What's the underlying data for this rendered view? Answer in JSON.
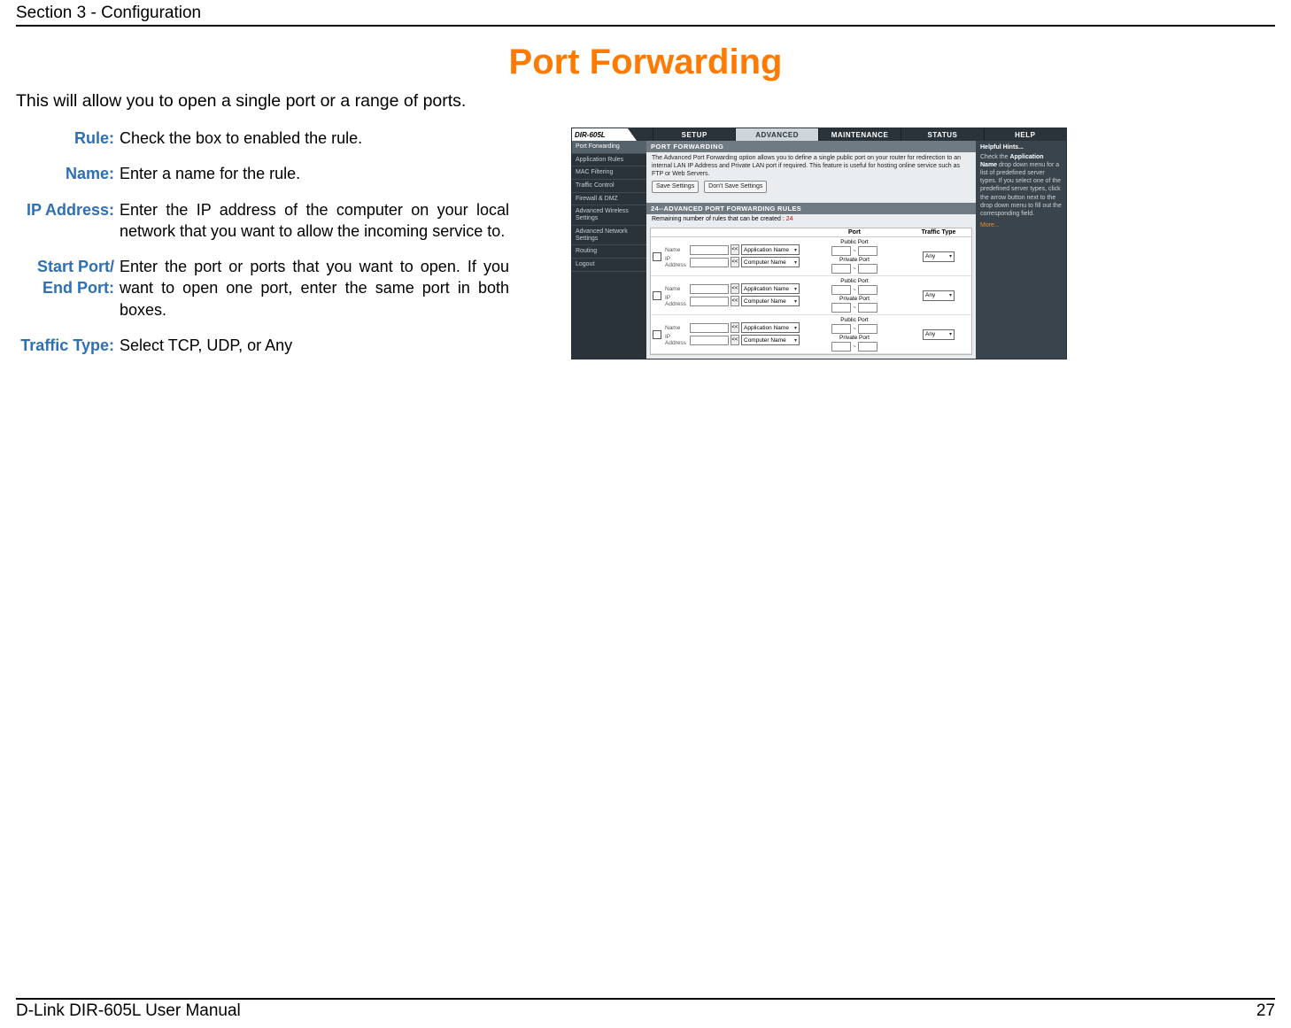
{
  "header": {
    "section": "Section 3 - Configuration"
  },
  "title": "Port Forwarding",
  "intro": "This will allow you to open a single port or a range of ports.",
  "defs": [
    {
      "term": "Rule:",
      "def": "Check the box to enabled the rule."
    },
    {
      "term": "Name:",
      "def": "Enter a name for the rule."
    },
    {
      "term": "IP Address:",
      "def": "Enter the IP address of the computer on your local network that you want to allow the incoming service to."
    },
    {
      "term": "Start Port/ End Port:",
      "def": "Enter the port or ports that you want to open. If you want to open one port, enter the same port in both boxes."
    },
    {
      "term": "Traffic Type:",
      "def": "Select TCP, UDP, or Any"
    }
  ],
  "screenshot": {
    "model": "DIR-605L",
    "tabs": [
      "SETUP",
      "ADVANCED",
      "MAINTENANCE",
      "STATUS",
      "HELP"
    ],
    "active_tab": "ADVANCED",
    "sidebar": [
      "Port Forwarding",
      "Application Rules",
      "MAC Filtering",
      "Traffic Control",
      "Firewall & DMZ",
      "Advanced Wireless Settings",
      "Advanced Network Settings",
      "Routing",
      "Logout"
    ],
    "sidebar_active": "Port Forwarding",
    "panel_title": "PORT FORWARDING",
    "panel_desc": "The Advanced Port Forwarding option allows you to define a single public port on your router for redirection to an internal LAN IP Address and Private LAN port if required. This feature is useful for hosting online service such as FTP or Web Servers.",
    "save_btn": "Save Settings",
    "dont_save_btn": "Don't Save Settings",
    "rules_title": "24--ADVANCED PORT FORWARDING RULES",
    "rules_note_prefix": "Remaining number of rules that can be created : ",
    "rules_note_num": "24",
    "th": {
      "blank": "",
      "port": "Port",
      "traffic": "Traffic Type"
    },
    "labels": {
      "name": "Name",
      "ip": "IP Address",
      "app": "Application Name",
      "comp": "Computer Name",
      "pub": "Public Port",
      "priv": "Private Port",
      "any": "Any",
      "arrow": "<<"
    },
    "rows": 3,
    "help": {
      "title": "Helpful Hints...",
      "body_pre": "Check the ",
      "body_b1": "Application Name",
      "body_mid": " drop down menu for a list of predefined server types. If you select one of the predefined server types, click the arrow button next to the drop down menu to fill out the corresponding field.",
      "more": "More..."
    }
  },
  "footer": {
    "manual": "D-Link DIR-605L User Manual",
    "page": "27"
  }
}
